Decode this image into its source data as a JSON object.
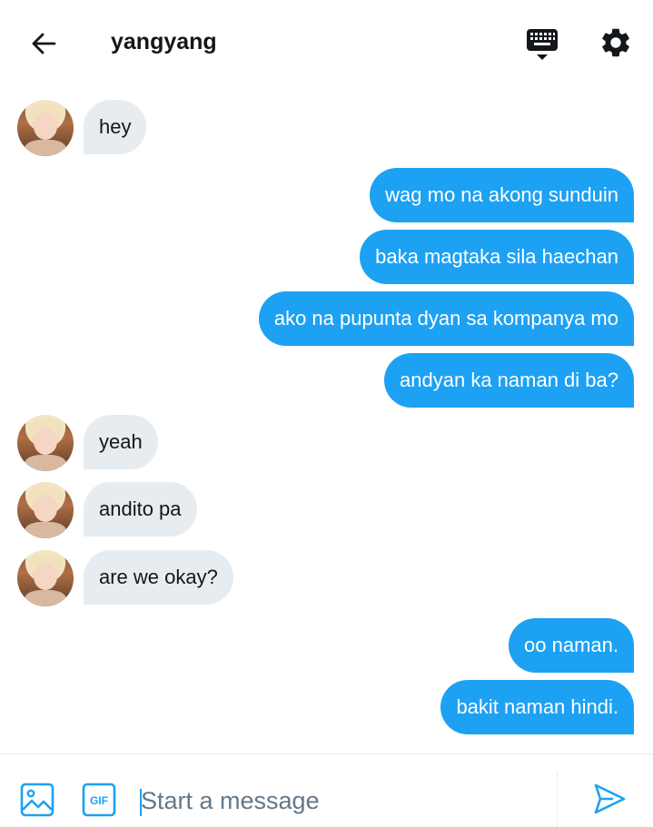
{
  "header": {
    "title": "yangyang",
    "icons": [
      "back-arrow-icon",
      "keyboard-icon",
      "gear-icon"
    ]
  },
  "messages": [
    {
      "direction": "incoming",
      "text": "hey"
    },
    {
      "direction": "outgoing",
      "text": "wag mo na akong sunduin"
    },
    {
      "direction": "outgoing",
      "text": "baka magtaka sila haechan"
    },
    {
      "direction": "outgoing",
      "text": "ako na pupunta dyan sa kompanya mo"
    },
    {
      "direction": "outgoing",
      "text": "andyan ka naman di ba?"
    },
    {
      "direction": "incoming",
      "text": "yeah"
    },
    {
      "direction": "incoming",
      "text": "andito pa"
    },
    {
      "direction": "incoming",
      "text": "are we okay?"
    },
    {
      "direction": "outgoing",
      "text": "oo naman."
    },
    {
      "direction": "outgoing",
      "text": "bakit naman hindi."
    }
  ],
  "composer": {
    "placeholder": "Start a message",
    "gif_label": "GIF",
    "icons": [
      "image-icon",
      "gif-icon",
      "send-icon"
    ]
  },
  "colors": {
    "accent": "#1da1f2",
    "incoming_bubble": "#e6ecf0",
    "text": "#14171a",
    "placeholder": "#657786"
  }
}
